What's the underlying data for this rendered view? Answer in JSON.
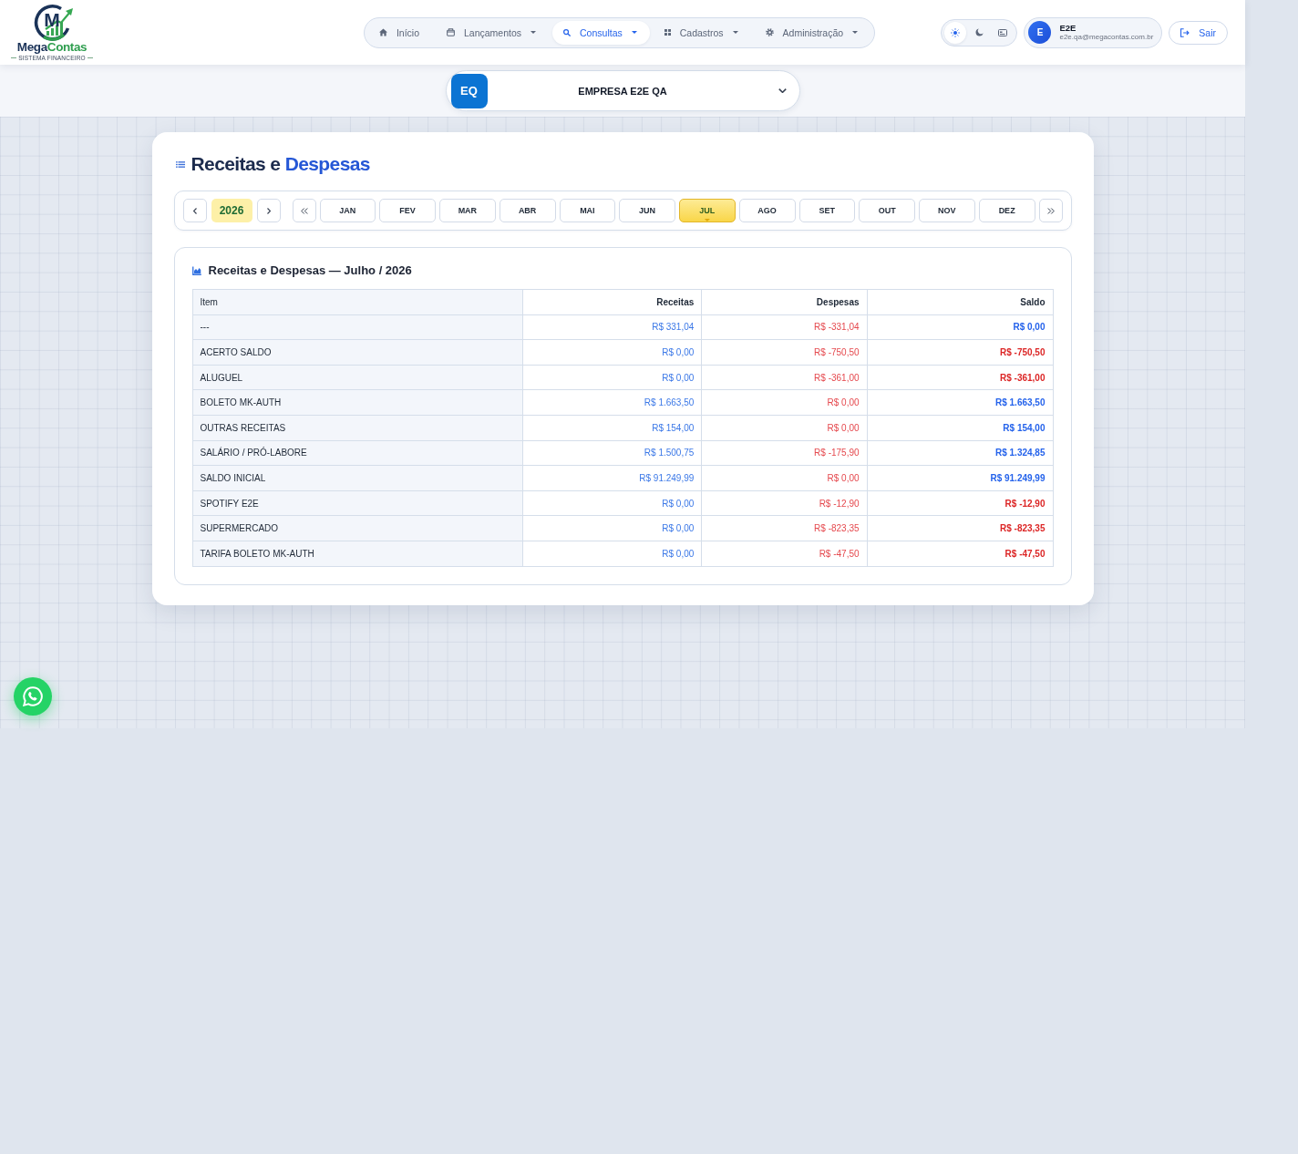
{
  "logo": {
    "mark": "M",
    "name_lead": "Mega",
    "name_accent": "Contas",
    "tagline": "SISTEMA FINANCEIRO"
  },
  "nav": [
    {
      "label": "Início",
      "kind": "home",
      "selected": false,
      "has_menu": false
    },
    {
      "label": "Lançamentos",
      "kind": "entries",
      "selected": false,
      "has_menu": true
    },
    {
      "label": "Consultas",
      "kind": "search",
      "selected": true,
      "has_menu": true
    },
    {
      "label": "Cadastros",
      "kind": "records",
      "selected": false,
      "has_menu": true
    },
    {
      "label": "Administração",
      "kind": "admin",
      "selected": false,
      "has_menu": true
    }
  ],
  "theme_modes": [
    {
      "kind": "light",
      "selected": true
    },
    {
      "kind": "dark",
      "selected": false
    },
    {
      "kind": "system",
      "selected": false
    }
  ],
  "user": {
    "initial": "E",
    "name": "E2E",
    "email": "e2e.qa@megacontas.com.br"
  },
  "logout": {
    "label": "Sair"
  },
  "company": {
    "initials": "EQ",
    "name": "EMPRESA E2E QA"
  },
  "title": {
    "lead": "Receitas e",
    "accent": "Despesas"
  },
  "period": {
    "year": "2026",
    "months": [
      {
        "label": "JAN",
        "selected": false
      },
      {
        "label": "FEV",
        "selected": false
      },
      {
        "label": "MAR",
        "selected": false
      },
      {
        "label": "ABR",
        "selected": false
      },
      {
        "label": "MAI",
        "selected": false
      },
      {
        "label": "JUN",
        "selected": false
      },
      {
        "label": "JUL",
        "selected": true
      },
      {
        "label": "AGO",
        "selected": false
      },
      {
        "label": "SET",
        "selected": false
      },
      {
        "label": "OUT",
        "selected": false
      },
      {
        "label": "NOV",
        "selected": false
      },
      {
        "label": "DEZ",
        "selected": false
      }
    ]
  },
  "report": {
    "title": "Receitas e Despesas — Julho / 2026",
    "columns": [
      "Item",
      "Receitas",
      "Despesas",
      "Saldo"
    ],
    "rows": [
      {
        "item": "---",
        "receitas": "R$ 331,04",
        "despesas": "R$ -331,04",
        "saldo": "R$ 0,00",
        "saldo_negative": false
      },
      {
        "item": "ACERTO SALDO",
        "receitas": "R$ 0,00",
        "despesas": "R$ -750,50",
        "saldo": "R$ -750,50",
        "saldo_negative": true
      },
      {
        "item": "ALUGUEL",
        "receitas": "R$ 0,00",
        "despesas": "R$ -361,00",
        "saldo": "R$ -361,00",
        "saldo_negative": true
      },
      {
        "item": "BOLETO MK-AUTH",
        "receitas": "R$ 1.663,50",
        "despesas": "R$ 0,00",
        "saldo": "R$ 1.663,50",
        "saldo_negative": false
      },
      {
        "item": "OUTRAS RECEITAS",
        "receitas": "R$ 154,00",
        "despesas": "R$ 0,00",
        "saldo": "R$ 154,00",
        "saldo_negative": false
      },
      {
        "item": "SALÁRIO / PRÓ-LABORE",
        "receitas": "R$ 1.500,75",
        "despesas": "R$ -175,90",
        "saldo": "R$ 1.324,85",
        "saldo_negative": false
      },
      {
        "item": "SALDO INICIAL",
        "receitas": "R$ 91.249,99",
        "despesas": "R$ 0,00",
        "saldo": "R$ 91.249,99",
        "saldo_negative": false
      },
      {
        "item": "SPOTIFY E2E",
        "receitas": "R$ 0,00",
        "despesas": "R$ -12,90",
        "saldo": "R$ -12,90",
        "saldo_negative": true
      },
      {
        "item": "SUPERMERCADO",
        "receitas": "R$ 0,00",
        "despesas": "R$ -823,35",
        "saldo": "R$ -823,35",
        "saldo_negative": true
      },
      {
        "item": "TARIFA BOLETO MK-AUTH",
        "receitas": "R$ 0,00",
        "despesas": "R$ -47,50",
        "saldo": "R$ -47,50",
        "saldo_negative": true
      }
    ]
  }
}
